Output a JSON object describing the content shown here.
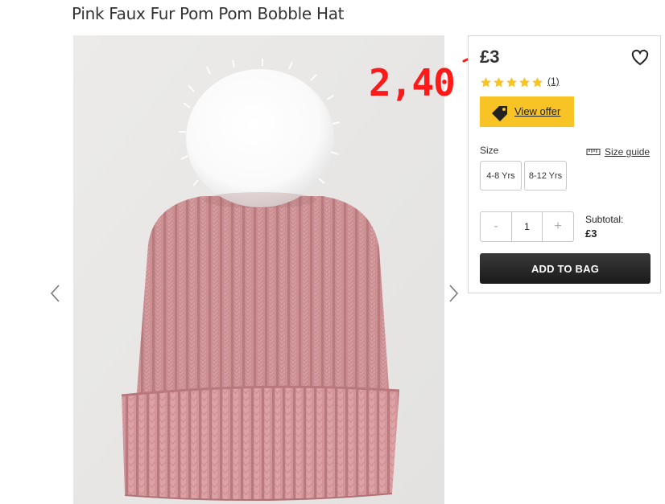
{
  "product": {
    "title": "Pink Faux Fur Pom Pom Bobble Hat",
    "price": "£3",
    "rating": 5,
    "review_count": "(1)",
    "offer_label": "View offer"
  },
  "annotation": {
    "new_price": "2,40",
    "color": "#ff1a1a"
  },
  "size": {
    "label": "Size",
    "guide_label": "Size guide",
    "options": [
      "4-8 Yrs",
      "8-12 Yrs"
    ]
  },
  "quantity": {
    "minus": "-",
    "value": "1",
    "plus": "+"
  },
  "subtotal": {
    "label": "Subtotal:",
    "value": "£3"
  },
  "add_to_bag_label": "ADD TO BAG",
  "colors": {
    "offer_bg": "#f7c325",
    "star": "#f7c325",
    "button_dark": "#222222",
    "hat_pink": "#d89a9c",
    "pompom": "#ffffff"
  },
  "icons": {
    "wishlist": "heart-icon",
    "offer": "price-tag-icon",
    "size_guide": "ruler-icon",
    "prev": "chevron-left-icon",
    "next": "chevron-right-icon"
  }
}
